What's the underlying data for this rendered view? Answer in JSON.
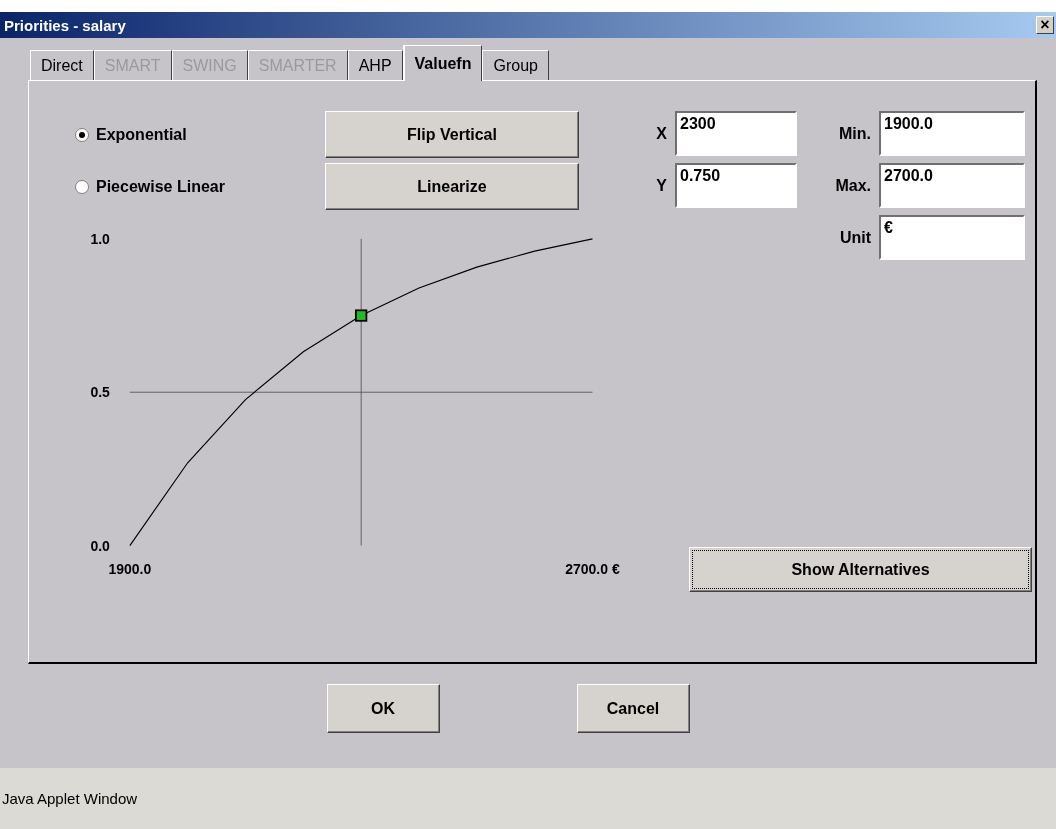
{
  "window": {
    "title": "Priorities - salary",
    "close": "×"
  },
  "tabs": [
    {
      "label": "Direct",
      "selected": false,
      "disabled": false
    },
    {
      "label": "SMART",
      "selected": false,
      "disabled": true
    },
    {
      "label": "SWING",
      "selected": false,
      "disabled": true
    },
    {
      "label": "SMARTER",
      "selected": false,
      "disabled": true
    },
    {
      "label": "AHP",
      "selected": false,
      "disabled": false
    },
    {
      "label": "Valuefn",
      "selected": true,
      "disabled": false
    },
    {
      "label": "Group",
      "selected": false,
      "disabled": false
    }
  ],
  "function_types": [
    {
      "label": "Exponential",
      "selected": true
    },
    {
      "label": "Piecewise Linear",
      "selected": false
    }
  ],
  "actions": [
    "Flip Vertical",
    "Linearize"
  ],
  "point_fields": [
    {
      "label": "X",
      "value": "2300"
    },
    {
      "label": "Y",
      "value": "0.750"
    }
  ],
  "range_fields": [
    {
      "label": "Min.",
      "value": "1900.0"
    },
    {
      "label": "Max.",
      "value": "2700.0"
    },
    {
      "label": "Unit",
      "value": "€"
    }
  ],
  "chart": {
    "chart_data": {
      "type": "line",
      "x": [
        1900,
        2000,
        2100,
        2200,
        2300,
        2400,
        2500,
        2600,
        2700
      ],
      "series": [
        {
          "color": "#000000",
          "values": [
            0,
            0.27,
            0.476,
            0.632,
            0.75,
            0.84,
            0.908,
            0.96,
            1
          ]
        }
      ],
      "xlim": [
        1900,
        2700
      ],
      "ylim": [
        0,
        1
      ],
      "xticks": [
        {
          "value": 1900,
          "label": "1900.0"
        },
        {
          "value": 2700,
          "label": "2700.0  €"
        }
      ],
      "yticks": [
        {
          "value": 0,
          "label": "0.0"
        },
        {
          "value": 0.5,
          "label": "0.5"
        },
        {
          "value": 1,
          "label": "1.0"
        }
      ]
    }
  },
  "show_alternatives": {
    "label": "Show Alternatives",
    "focused": true
  },
  "buttons": [
    "OK",
    "Cancel"
  ],
  "status_bar": "Java Applet Window"
}
